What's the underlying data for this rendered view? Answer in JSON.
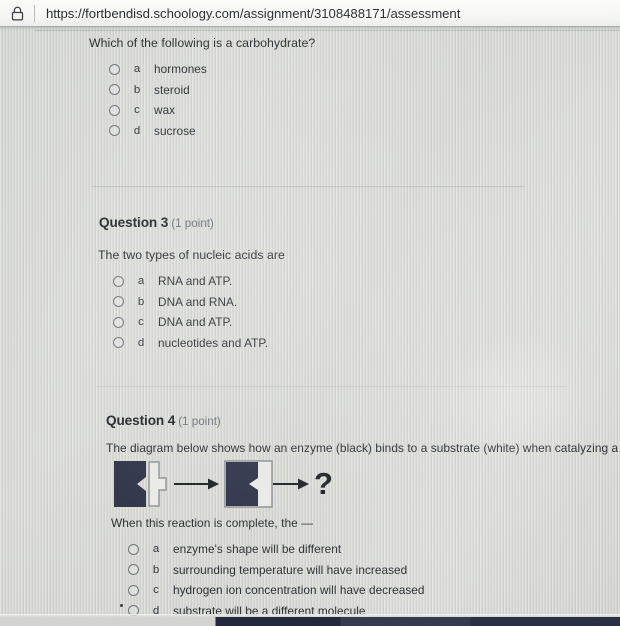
{
  "browser": {
    "lock_icon": "padlock-icon",
    "url": "https://fortbendisd.schoology.com/assignment/3108488171/assessment"
  },
  "assessment": {
    "questions": [
      {
        "id": "q2",
        "heading_visible": false,
        "heading_number": "",
        "points": "",
        "stem": "Which of the following is a carbohydrate?",
        "options": [
          {
            "letter": "a",
            "text": "hormones",
            "selected": false
          },
          {
            "letter": "b",
            "text": "steroid",
            "selected": false
          },
          {
            "letter": "c",
            "text": "wax",
            "selected": false
          },
          {
            "letter": "d",
            "text": "sucrose",
            "selected": false
          }
        ]
      },
      {
        "id": "q3",
        "heading_visible": true,
        "heading_number": "Question 3",
        "points": "(1 point)",
        "stem": "The two types of nucleic acids are",
        "options": [
          {
            "letter": "a",
            "text": "RNA and ATP.",
            "selected": false
          },
          {
            "letter": "b",
            "text": "DNA and RNA.",
            "selected": false
          },
          {
            "letter": "c",
            "text": "DNA and ATP.",
            "selected": false
          },
          {
            "letter": "d",
            "text": "nucleotides and ATP.",
            "selected": false
          }
        ]
      },
      {
        "id": "q4",
        "heading_visible": true,
        "heading_number": "Question 4",
        "points": "(1 point)",
        "stem": "The diagram below shows how an enzyme (black) binds to a substrate (white) when catalyzing a chemical rea",
        "sub_stem": "When this reaction is complete, the —",
        "diagram": {
          "name": "enzyme-substrate-diagram",
          "enzyme_color": "#2f3348",
          "substrate_fill": "#e8e9e5",
          "substrate_stroke": "#7b7f84",
          "arrow_color": "#1d2024",
          "question_mark": "?"
        },
        "options": [
          {
            "letter": "a",
            "text": "enzyme's shape will be different",
            "selected": false
          },
          {
            "letter": "b",
            "text": "surrounding temperature will have increased",
            "selected": false
          },
          {
            "letter": "c",
            "text": "hydrogen ion concentration will have decreased",
            "selected": false
          },
          {
            "letter": "d",
            "text": "substrate will be a different molecule",
            "selected": false
          }
        ]
      }
    ]
  },
  "theme": {
    "page_bg": "#d6d7d3",
    "urlbar_bg": "#f7f7f5",
    "text": "#2b2e32",
    "muted_text": "#6d7278",
    "divider": "#7a8080",
    "bottom_bar": "#23283c"
  }
}
